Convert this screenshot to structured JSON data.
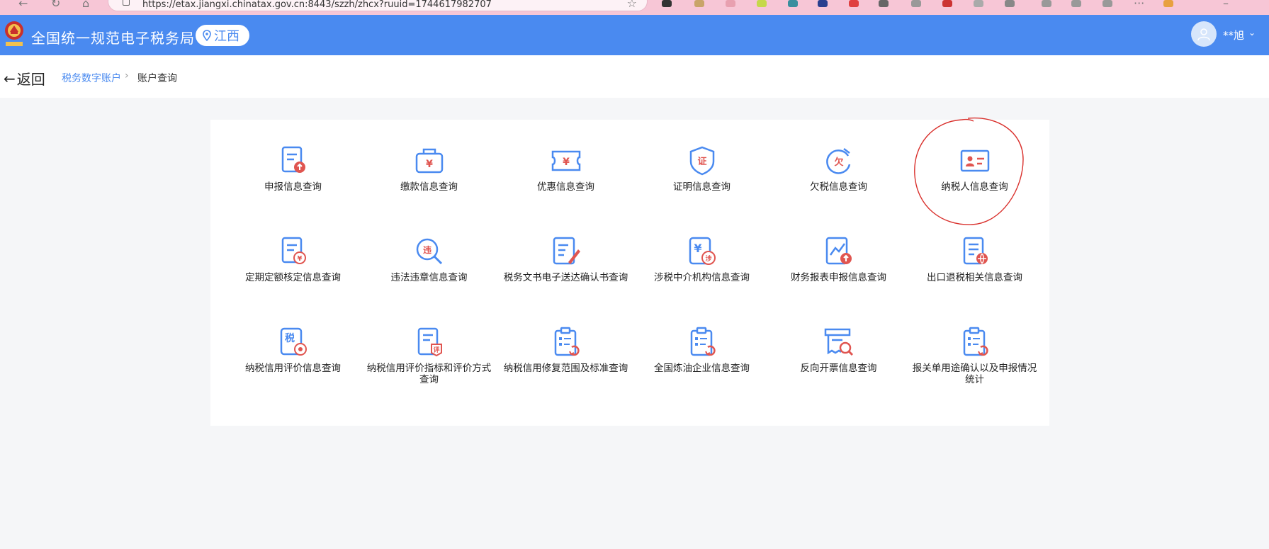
{
  "browser": {
    "url": "https://etax.jiangxi.chinatax.gov.cn:8443/szzh/zhcx?ruuid=1744617982707"
  },
  "header": {
    "title": "全国统一规范电子税务局",
    "region": "江西",
    "user_name": "**旭",
    "caret": "⌄"
  },
  "breadcrumb": {
    "back_label": "返回",
    "back_arrow": "←",
    "items": [
      "税务数字账户",
      "账户查询"
    ],
    "separator": "›"
  },
  "tiles": [
    {
      "label": "申报信息查询",
      "icon": "declaration-icon"
    },
    {
      "label": "缴款信息查询",
      "icon": "payment-icon"
    },
    {
      "label": "优惠信息查询",
      "icon": "ticket-icon"
    },
    {
      "label": "证明信息查询",
      "icon": "certificate-shield-icon"
    },
    {
      "label": "欠税信息查询",
      "icon": "arrears-icon"
    },
    {
      "label": "纳税人信息查询",
      "icon": "id-card-icon"
    },
    {
      "label": "定期定额核定信息查询",
      "icon": "fixed-quota-icon"
    },
    {
      "label": "违法违章信息查询",
      "icon": "violation-search-icon"
    },
    {
      "label": "税务文书电子送达确认书查询",
      "icon": "document-pen-icon"
    },
    {
      "label": "涉税中介机构信息查询",
      "icon": "agency-icon"
    },
    {
      "label": "财务报表申报信息查询",
      "icon": "financial-report-icon"
    },
    {
      "label": "出口退税相关信息查询",
      "icon": "export-rebate-icon"
    },
    {
      "label": "纳税信用评价信息查询",
      "icon": "credit-rating-icon"
    },
    {
      "label": "纳税信用评价指标和评价方式查询",
      "icon": "credit-index-icon"
    },
    {
      "label": "纳税信用修复范围及标准查询",
      "icon": "credit-repair-icon"
    },
    {
      "label": "全国炼油企业信息查询",
      "icon": "refinery-icon"
    },
    {
      "label": "反向开票信息查询",
      "icon": "reverse-invoice-icon"
    },
    {
      "label": "报关单用途确认以及申报情况统计",
      "icon": "customs-declaration-icon"
    }
  ],
  "icon_glyphs": {
    "payment": "¥",
    "ticket": "¥",
    "certificate": "证",
    "arrears": "欠",
    "fixed_quota": "¥",
    "violation": "违",
    "agency": "¥",
    "agency_badge": "涉",
    "credit": "税",
    "credit_index": "评"
  },
  "colors": {
    "header_bg": "#4a8af0",
    "accent_blue": "#4a8af0",
    "accent_red": "#e05550",
    "annotation_red": "#d9302c"
  }
}
